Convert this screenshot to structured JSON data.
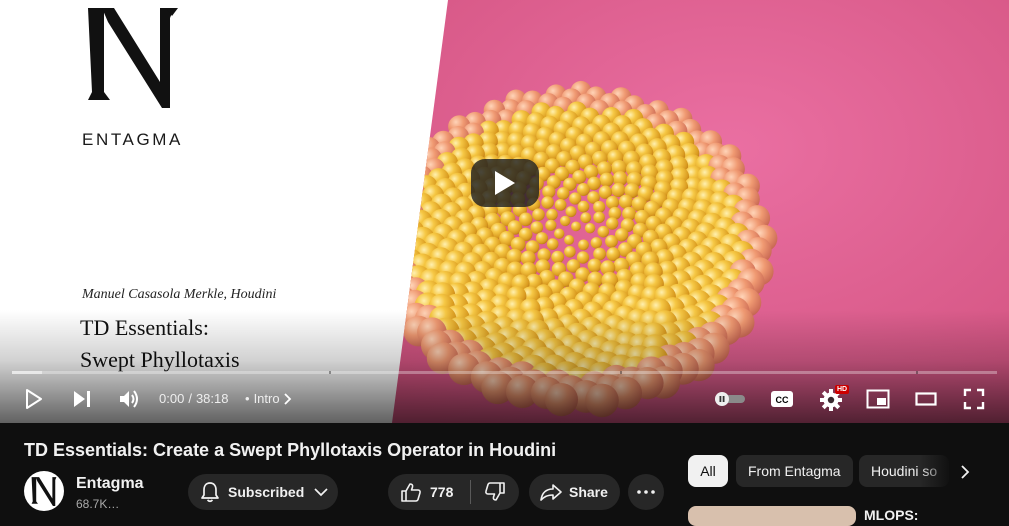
{
  "player": {
    "thumbnail": {
      "brand_letter": "N",
      "brand_name": "ENTAGMA",
      "author_line": "Manuel Casasola Merkle, Houdini",
      "title_lines": [
        "TD Essentials:",
        "Swept Phyllotaxis"
      ]
    },
    "time_current": "0:00",
    "time_separator": "/",
    "time_total": "38:18",
    "chapter_bullet": "•",
    "chapter_label": "Intro",
    "settings_badge": "HD",
    "icons": [
      "play-icon",
      "next-icon",
      "volume-icon",
      "autoplay-toggle-icon",
      "captions-icon",
      "settings-icon",
      "miniplayer-icon",
      "theater-icon",
      "fullscreen-icon"
    ],
    "colors": {
      "hd_badge": "#cc0000",
      "pink_backdrop": "#de5f94",
      "sphere_yellow": "#f2c13a"
    }
  },
  "video": {
    "title": "TD Essentials: Create a Swept Phyllotaxis Operator in Houdini"
  },
  "channel": {
    "name": "Entagma",
    "subscribers": "68.7K…",
    "subscribe_label": "Subscribed"
  },
  "actions": {
    "like_count": "778",
    "share_label": "Share"
  },
  "chips": [
    "All",
    "From Entagma",
    "Houdini so"
  ],
  "recommendation": {
    "title": "MLOPS:"
  }
}
